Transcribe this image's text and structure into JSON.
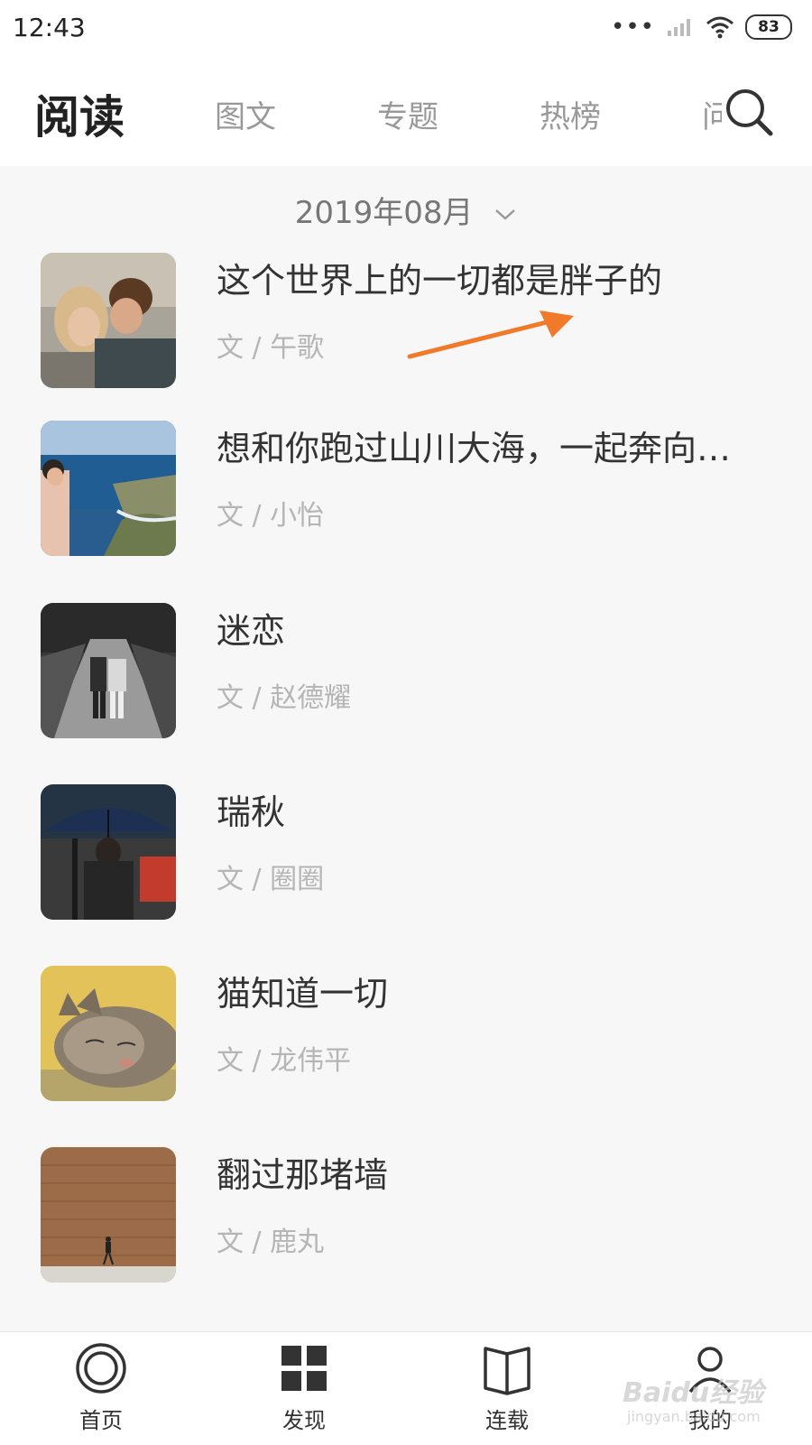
{
  "status_bar": {
    "time": "12:43",
    "signal_dots": "•••",
    "battery": "83",
    "icons": [
      "signal-icon",
      "wifi-icon",
      "battery-icon"
    ]
  },
  "header": {
    "title": "阅读",
    "tabs": [
      {
        "label": "图文"
      },
      {
        "label": "专题"
      },
      {
        "label": "热榜"
      },
      {
        "label": "问"
      }
    ],
    "search_icon": "search-icon"
  },
  "date_filter": {
    "label": "2019年08月",
    "icon": "chevron-down-icon"
  },
  "articles": [
    {
      "title": "这个世界上的一切都是胖子的",
      "author": "文 / 午歌",
      "thumb": "couple-kissing-photo"
    },
    {
      "title": "想和你跑过山川大海，一起奔向…",
      "author": "文 / 小怡",
      "thumb": "seaside-cliff-photo"
    },
    {
      "title": "迷恋",
      "author": "文 / 赵德耀",
      "thumb": "couple-walking-road-photo"
    },
    {
      "title": "瑞秋",
      "author": "文 / 圈圈",
      "thumb": "umbrella-street-photo"
    },
    {
      "title": "猫知道一切",
      "author": "文 / 龙伟平",
      "thumb": "sleeping-cat-photo"
    },
    {
      "title": "翻过那堵墙",
      "author": "文 / 鹿丸",
      "thumb": "brick-wall-photo"
    }
  ],
  "annotation": {
    "color": "#f07a2a",
    "icon": "arrow-annotation"
  },
  "bottom_nav": [
    {
      "label": "首页",
      "icon": "home-ring-icon"
    },
    {
      "label": "发现",
      "icon": "grid-icon"
    },
    {
      "label": "连载",
      "icon": "book-icon"
    },
    {
      "label": "我的",
      "icon": "user-icon"
    }
  ],
  "watermark": {
    "text": "Baidu经验",
    "sub": "jingyan.baidu.com"
  }
}
